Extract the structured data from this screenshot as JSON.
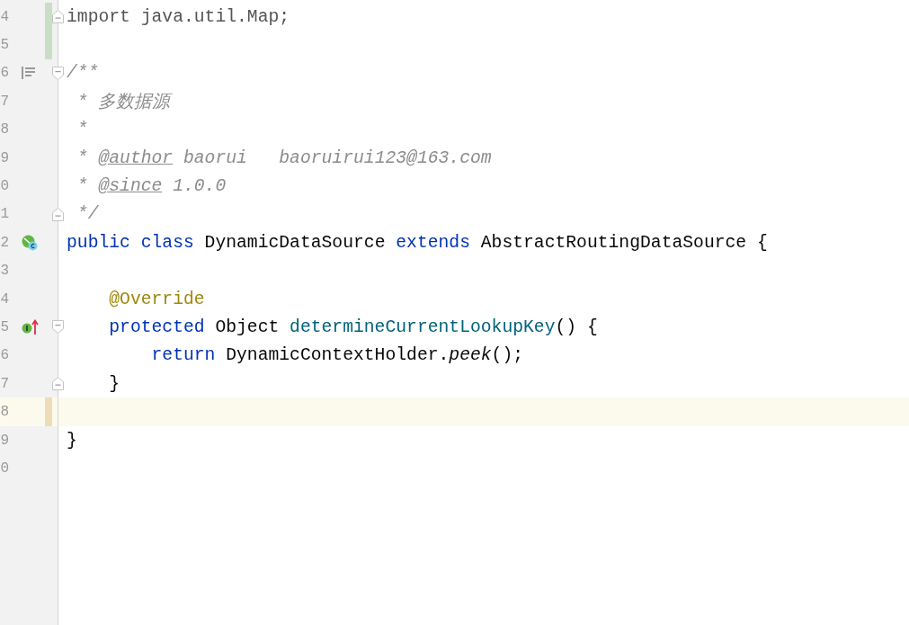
{
  "editor": {
    "lines": [
      {
        "number": "4",
        "added": true,
        "current": false,
        "fold": {
          "kind": "end"
        },
        "tokens": [
          {
            "text": "import java.util.Map;",
            "kind": "unused"
          }
        ]
      },
      {
        "number": "5",
        "added": true,
        "current": false
      },
      {
        "number": "6",
        "added": false,
        "current": false,
        "fold": {
          "kind": "start"
        },
        "gutter_icon": {
          "kind": "doc"
        },
        "tokens": [
          {
            "text": "/**",
            "kind": "comment"
          }
        ]
      },
      {
        "number": "7",
        "added": false,
        "current": false,
        "tokens": [
          {
            "text": " * 多数据源",
            "kind": "comment"
          }
        ]
      },
      {
        "number": "8",
        "added": false,
        "current": false,
        "tokens": [
          {
            "text": " *",
            "kind": "comment"
          }
        ]
      },
      {
        "number": "9",
        "added": false,
        "current": false,
        "tokens": [
          {
            "text": " * ",
            "kind": "comment"
          },
          {
            "text": "@author",
            "kind": "doctag"
          },
          {
            "text": " baorui   baoruirui123@163.com",
            "kind": "comment"
          }
        ]
      },
      {
        "number": "0",
        "added": false,
        "current": false,
        "tokens": [
          {
            "text": " * ",
            "kind": "comment"
          },
          {
            "text": "@since",
            "kind": "doctag"
          },
          {
            "text": " 1.0.0",
            "kind": "comment"
          }
        ]
      },
      {
        "number": "1",
        "added": false,
        "current": false,
        "fold": {
          "kind": "end"
        },
        "tokens": [
          {
            "text": " */",
            "kind": "comment"
          }
        ]
      },
      {
        "number": "2",
        "added": false,
        "current": false,
        "gutter_icon": {
          "kind": "class"
        },
        "tokens": [
          {
            "text": "public",
            "kind": "keyword"
          },
          {
            "text": " class",
            "kind": "keyword"
          },
          {
            "text": " DynamicDataSource ",
            "kind": "plain"
          },
          {
            "text": "extends",
            "kind": "keyword"
          },
          {
            "text": " AbstractRoutingDataSource {",
            "kind": "plain"
          }
        ]
      },
      {
        "number": "3",
        "added": false,
        "current": false
      },
      {
        "number": "4",
        "added": false,
        "current": false,
        "tokens": [
          {
            "text": "    @Override",
            "kind": "annotation"
          }
        ]
      },
      {
        "number": "5",
        "added": false,
        "current": false,
        "fold": {
          "kind": "start"
        },
        "gutter_icon": {
          "kind": "implements"
        },
        "tokens": [
          {
            "text": "    protected",
            "kind": "keyword"
          },
          {
            "text": " Object ",
            "kind": "plain"
          },
          {
            "text": "determineCurrentLookupKey",
            "kind": "method"
          },
          {
            "text": "() {",
            "kind": "plain"
          }
        ]
      },
      {
        "number": "6",
        "added": false,
        "current": false,
        "tokens": [
          {
            "text": "        return",
            "kind": "keyword"
          },
          {
            "text": " DynamicContextHolder.",
            "kind": "plain"
          },
          {
            "text": "peek",
            "kind": "static"
          },
          {
            "text": "();",
            "kind": "plain"
          }
        ]
      },
      {
        "number": "7",
        "added": false,
        "current": false,
        "fold": {
          "kind": "end"
        },
        "tokens": [
          {
            "text": "    }",
            "kind": "plain"
          }
        ]
      },
      {
        "number": "8",
        "added": false,
        "current": true
      },
      {
        "number": "9",
        "added": false,
        "current": false,
        "tokens": [
          {
            "text": "}",
            "kind": "plain"
          }
        ]
      },
      {
        "number": "0",
        "added": false,
        "current": false
      }
    ]
  }
}
